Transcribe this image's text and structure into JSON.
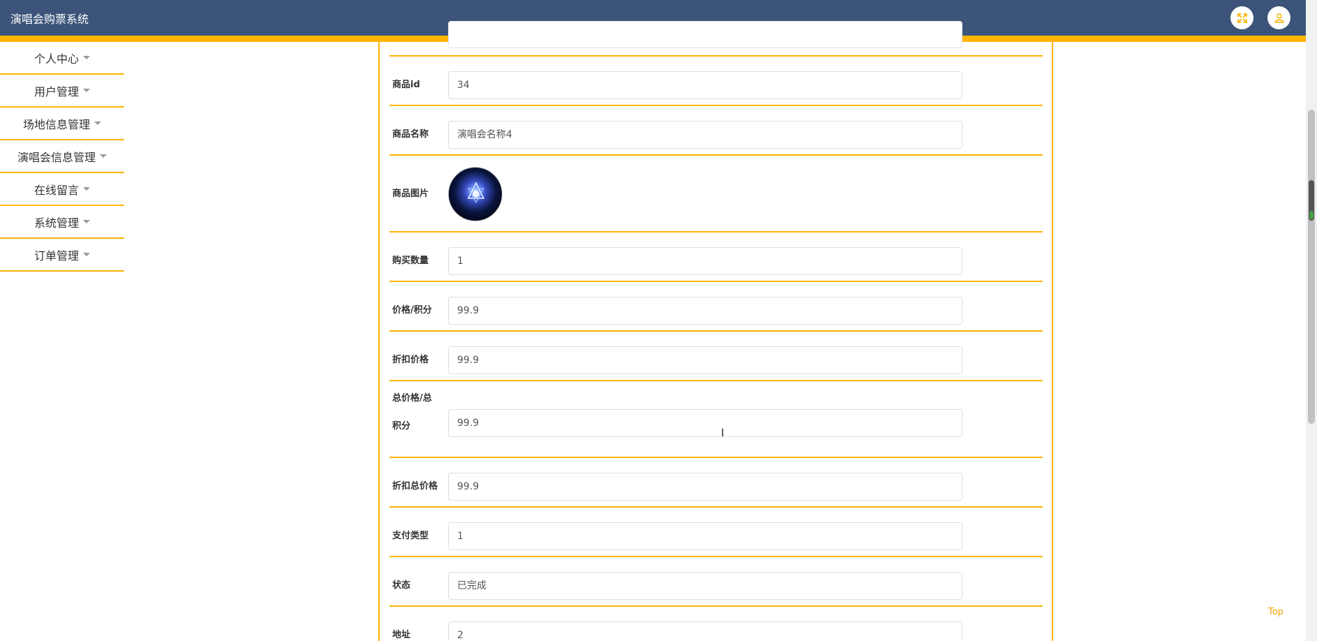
{
  "header": {
    "title": "演唱会购票系统"
  },
  "sidebar": {
    "items": [
      {
        "label": "个人中心"
      },
      {
        "label": "用户管理"
      },
      {
        "label": "场地信息管理"
      },
      {
        "label": "演唱会信息管理"
      },
      {
        "label": "在线留言"
      },
      {
        "label": "系统管理"
      },
      {
        "label": "订单管理"
      }
    ]
  },
  "form": {
    "product_id": {
      "label": "商品id",
      "value": "34"
    },
    "product_name": {
      "label": "商品名称",
      "value": "演唱会名称4"
    },
    "product_image": {
      "label": "商品图片"
    },
    "quantity": {
      "label": "购买数量",
      "value": "1"
    },
    "price": {
      "label": "价格/积分",
      "value": "99.9"
    },
    "discount_price": {
      "label": "折扣价格",
      "value": "99.9"
    },
    "total_price": {
      "label_line1": "总价格/总",
      "label_line2": "积分",
      "value": "99.9"
    },
    "discount_total": {
      "label": "折扣总价格",
      "value": "99.9"
    },
    "pay_type": {
      "label": "支付类型",
      "value": "1"
    },
    "status": {
      "label": "状态",
      "value": "已完成"
    },
    "address": {
      "label": "地址",
      "value": "2"
    }
  },
  "footer": {
    "top_label": "Top"
  },
  "colors": {
    "header_bg": "#3c5479",
    "accent": "#ffb400"
  },
  "icons": {
    "expand": "fullscreen-icon",
    "user": "user-icon"
  }
}
